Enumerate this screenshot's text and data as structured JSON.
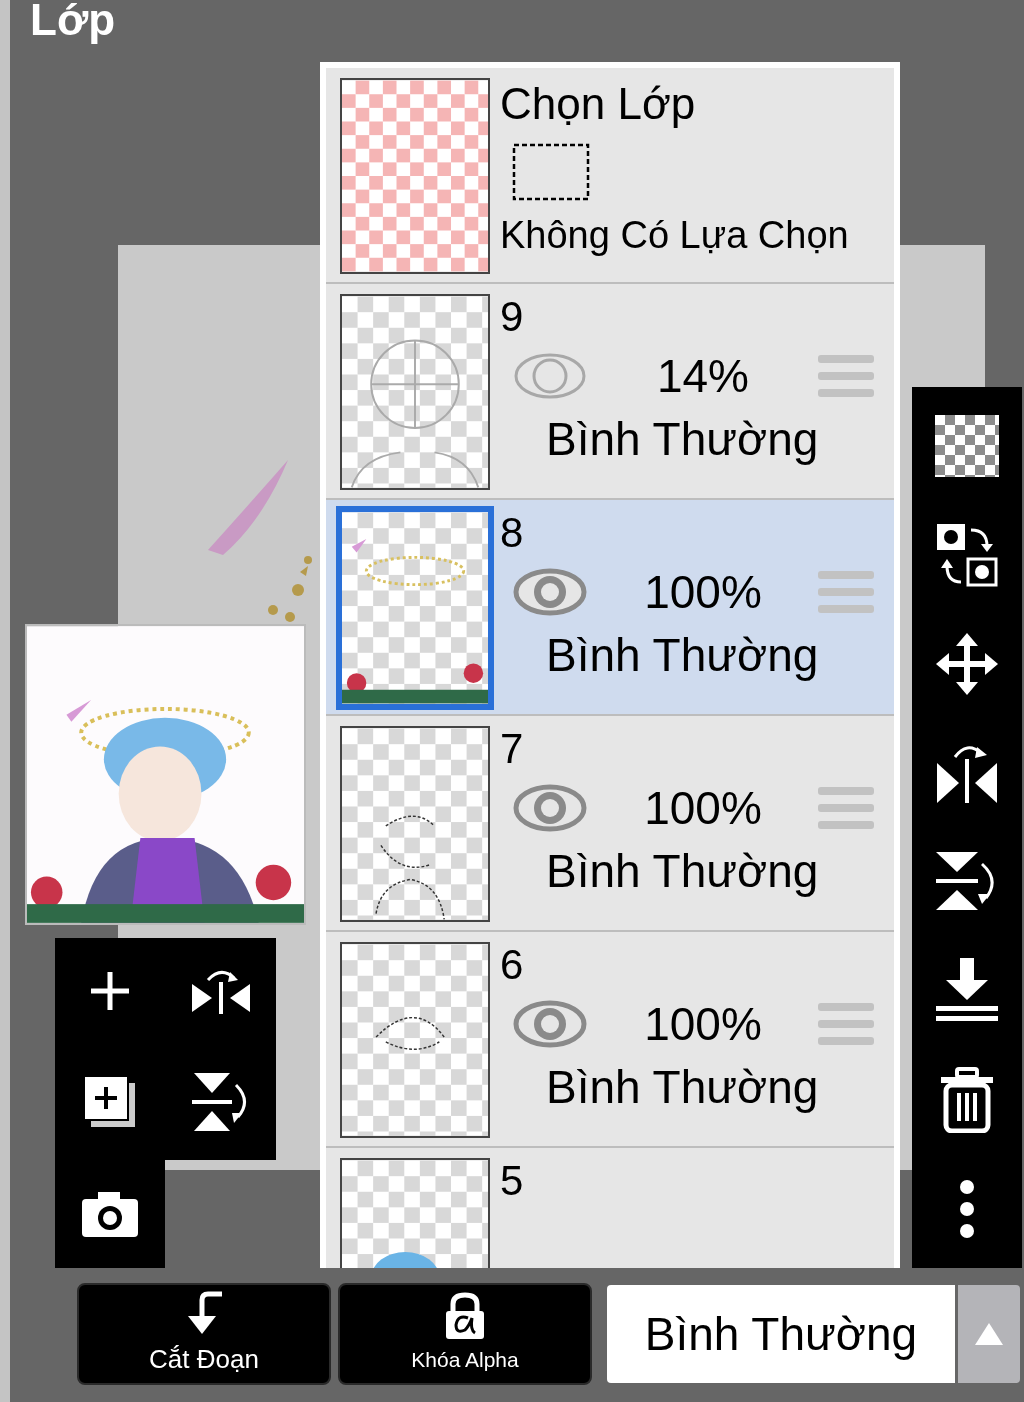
{
  "title": "Lớp",
  "selection_layer": {
    "title": "Chọn Lớp",
    "status": "Không Có Lựa Chọn"
  },
  "layers": [
    {
      "name": "9",
      "visible": false,
      "opacity": "14%",
      "blend": "Bình Thường",
      "selected": false
    },
    {
      "name": "8",
      "visible": true,
      "opacity": "100%",
      "blend": "Bình Thường",
      "selected": true
    },
    {
      "name": "7",
      "visible": true,
      "opacity": "100%",
      "blend": "Bình Thường",
      "selected": false
    },
    {
      "name": "6",
      "visible": true,
      "opacity": "100%",
      "blend": "Bình Thường",
      "selected": false
    },
    {
      "name": "5",
      "selected": false
    }
  ],
  "bottom_buttons": [
    {
      "label": "Cắt Đoạn",
      "kind": "clip"
    },
    {
      "label": "Khóa Alpha",
      "kind": "alpha-lock"
    }
  ],
  "blend_mode": {
    "value": "Bình Thường"
  }
}
